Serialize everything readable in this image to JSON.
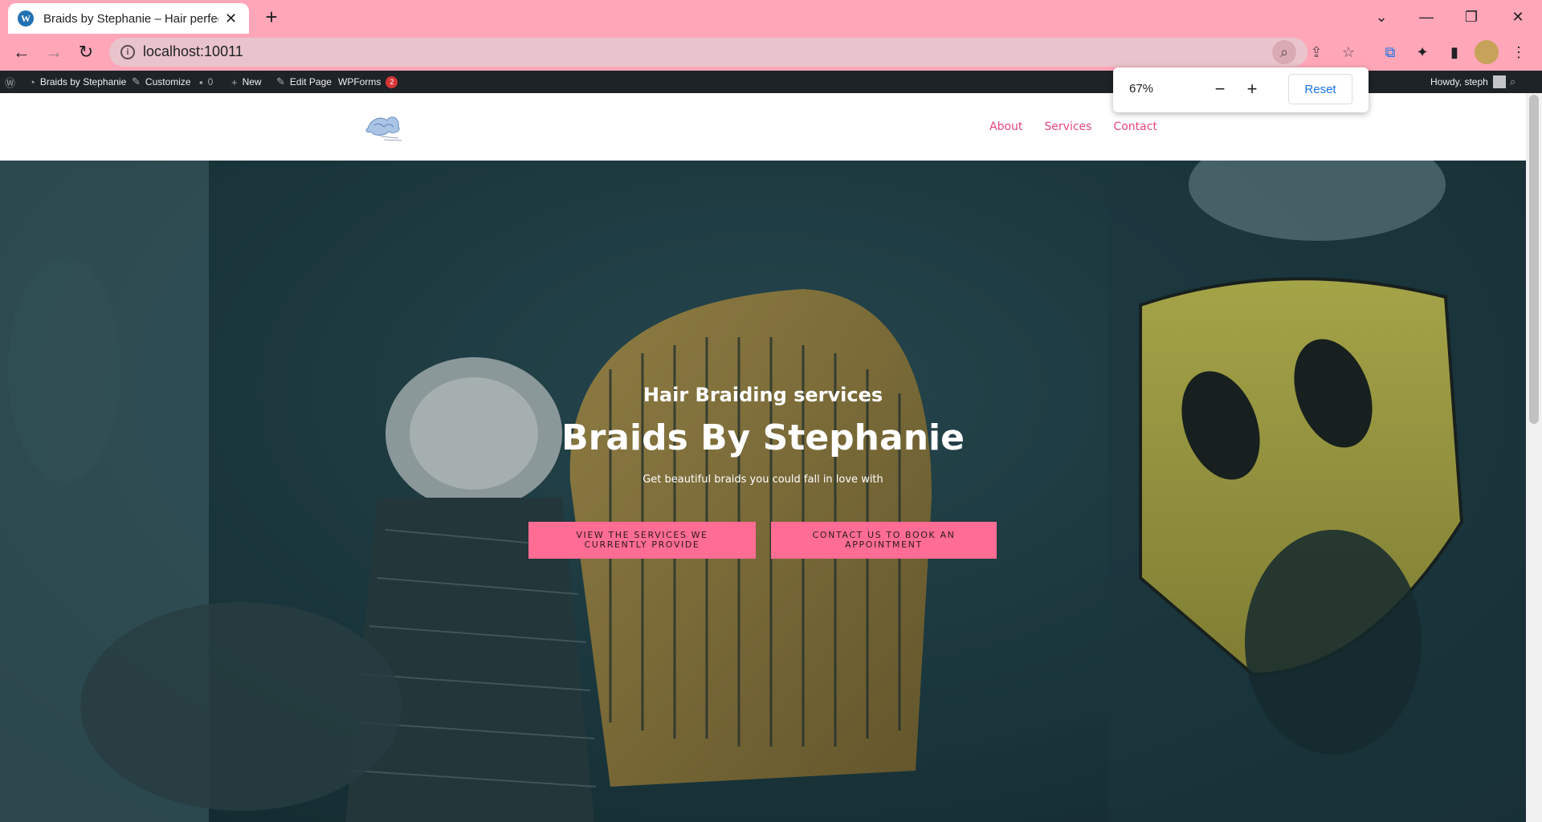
{
  "browser": {
    "tab_title": "Braids by Stephanie – Hair perfec",
    "tab_icon": "wordpress-icon",
    "url": "localhost:10011",
    "zoom": {
      "level": "67%",
      "reset_label": "Reset"
    }
  },
  "admin_bar": {
    "site_name": "Braids by Stephanie",
    "customize": "Customize",
    "comments_count": "0",
    "new": "New",
    "edit_page": "Edit Page",
    "wpforms": "WPForms",
    "wpforms_badge": "2",
    "howdy": "Howdy, steph"
  },
  "site": {
    "nav": [
      {
        "label": "About"
      },
      {
        "label": "Services"
      },
      {
        "label": "Contact"
      }
    ],
    "accent_color": "#e8467d"
  },
  "hero": {
    "subtitle": "Hair Braiding services",
    "title": "Braids By Stephanie",
    "tagline": "Get beautiful braids you could fall in love with",
    "buttons": [
      {
        "label": "VIEW THE SERVICES WE CURRENTLY PROVIDE"
      },
      {
        "label": "CONTACT US TO BOOK AN APPOINTMENT"
      }
    ],
    "button_color": "#ff6c94"
  }
}
